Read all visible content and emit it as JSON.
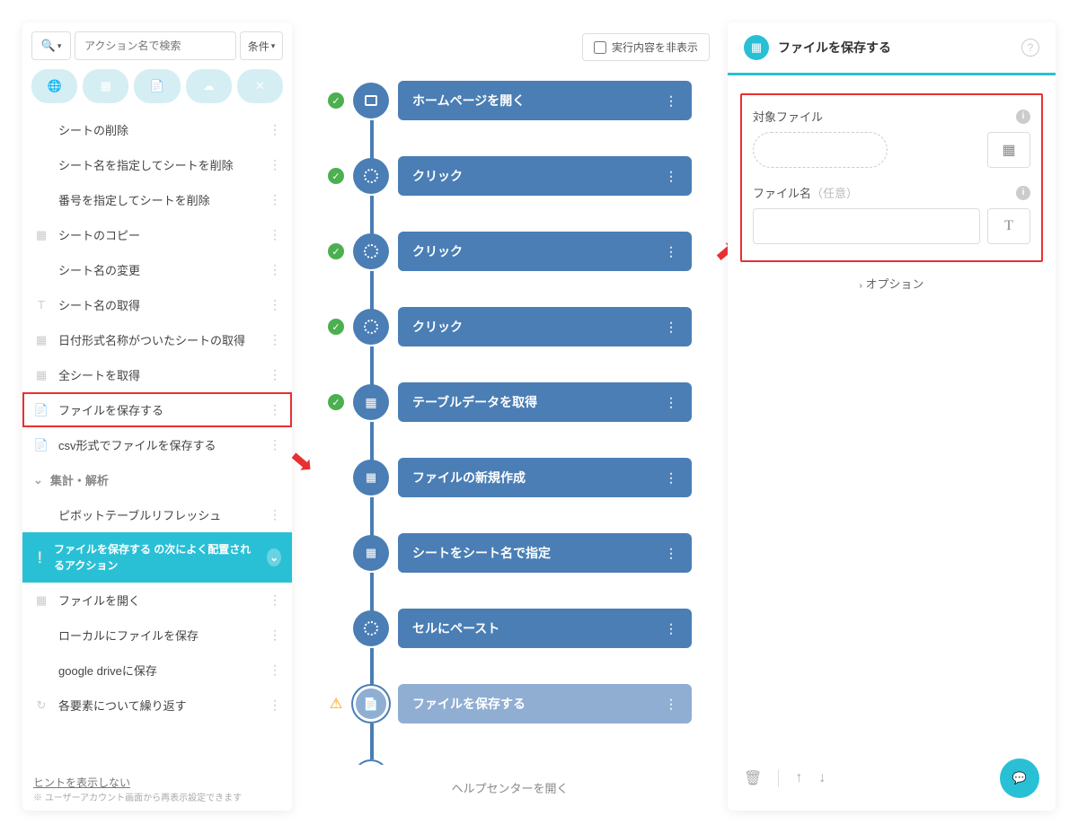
{
  "search": {
    "placeholder": "アクション名で検索",
    "condition_label": "条件"
  },
  "hide_exec_label": "実行内容を非表示",
  "sidebar_actions": [
    {
      "label": "シートの削除",
      "icon": ""
    },
    {
      "label": "シート名を指定してシートを削除",
      "icon": ""
    },
    {
      "label": "番号を指定してシートを削除",
      "icon": ""
    },
    {
      "label": "シートのコピー",
      "icon": "excel"
    },
    {
      "label": "シート名の変更",
      "icon": ""
    },
    {
      "label": "シート名の取得",
      "icon": "text"
    },
    {
      "label": "日付形式名称がついたシートの取得",
      "icon": "grid"
    },
    {
      "label": "全シートを取得",
      "icon": "grid"
    },
    {
      "label": "ファイルを保存する",
      "icon": "file",
      "selected": true
    },
    {
      "label": "csv形式でファイルを保存する",
      "icon": "file"
    }
  ],
  "category_label": "集計・解析",
  "category_actions": [
    {
      "label": "ピボットテーブルリフレッシュ",
      "icon": ""
    }
  ],
  "suggestion": {
    "prefix": "ファイルを保存する",
    "suffix": " の次によく配置されるアクション"
  },
  "suggestion_actions": [
    {
      "label": "ファイルを開く",
      "icon": "excel"
    },
    {
      "label": "ローカルにファイルを保存",
      "icon": ""
    },
    {
      "label": "google driveに保存",
      "icon": ""
    },
    {
      "label": "各要素について繰り返す",
      "icon": "repeat"
    }
  ],
  "hint": {
    "link": "ヒントを表示しない",
    "sub": "※ ユーザーアカウント画面から再表示設定できます"
  },
  "flow_nodes": [
    {
      "label": "ホームページを開く",
      "status": "ok",
      "icon": "window"
    },
    {
      "label": "クリック",
      "status": "ok",
      "icon": "target"
    },
    {
      "label": "クリック",
      "status": "ok",
      "icon": "target"
    },
    {
      "label": "クリック",
      "status": "ok",
      "icon": "target"
    },
    {
      "label": "テーブルデータを取得",
      "status": "ok",
      "icon": "table"
    },
    {
      "label": "ファイルの新規作成",
      "status": "",
      "icon": "excel"
    },
    {
      "label": "シートをシート名で指定",
      "status": "",
      "icon": "excel"
    },
    {
      "label": "セルにペースト",
      "status": "",
      "icon": "target"
    },
    {
      "label": "ファイルを保存する",
      "status": "warn",
      "icon": "file",
      "selected": true
    }
  ],
  "canvas_footer": "ヘルプセンターを開く",
  "props": {
    "title": "ファイルを保存する",
    "target_file_label": "対象ファイル",
    "filename_label": "ファイル名",
    "filename_optional": "（任意）",
    "options_label": "オプション"
  }
}
